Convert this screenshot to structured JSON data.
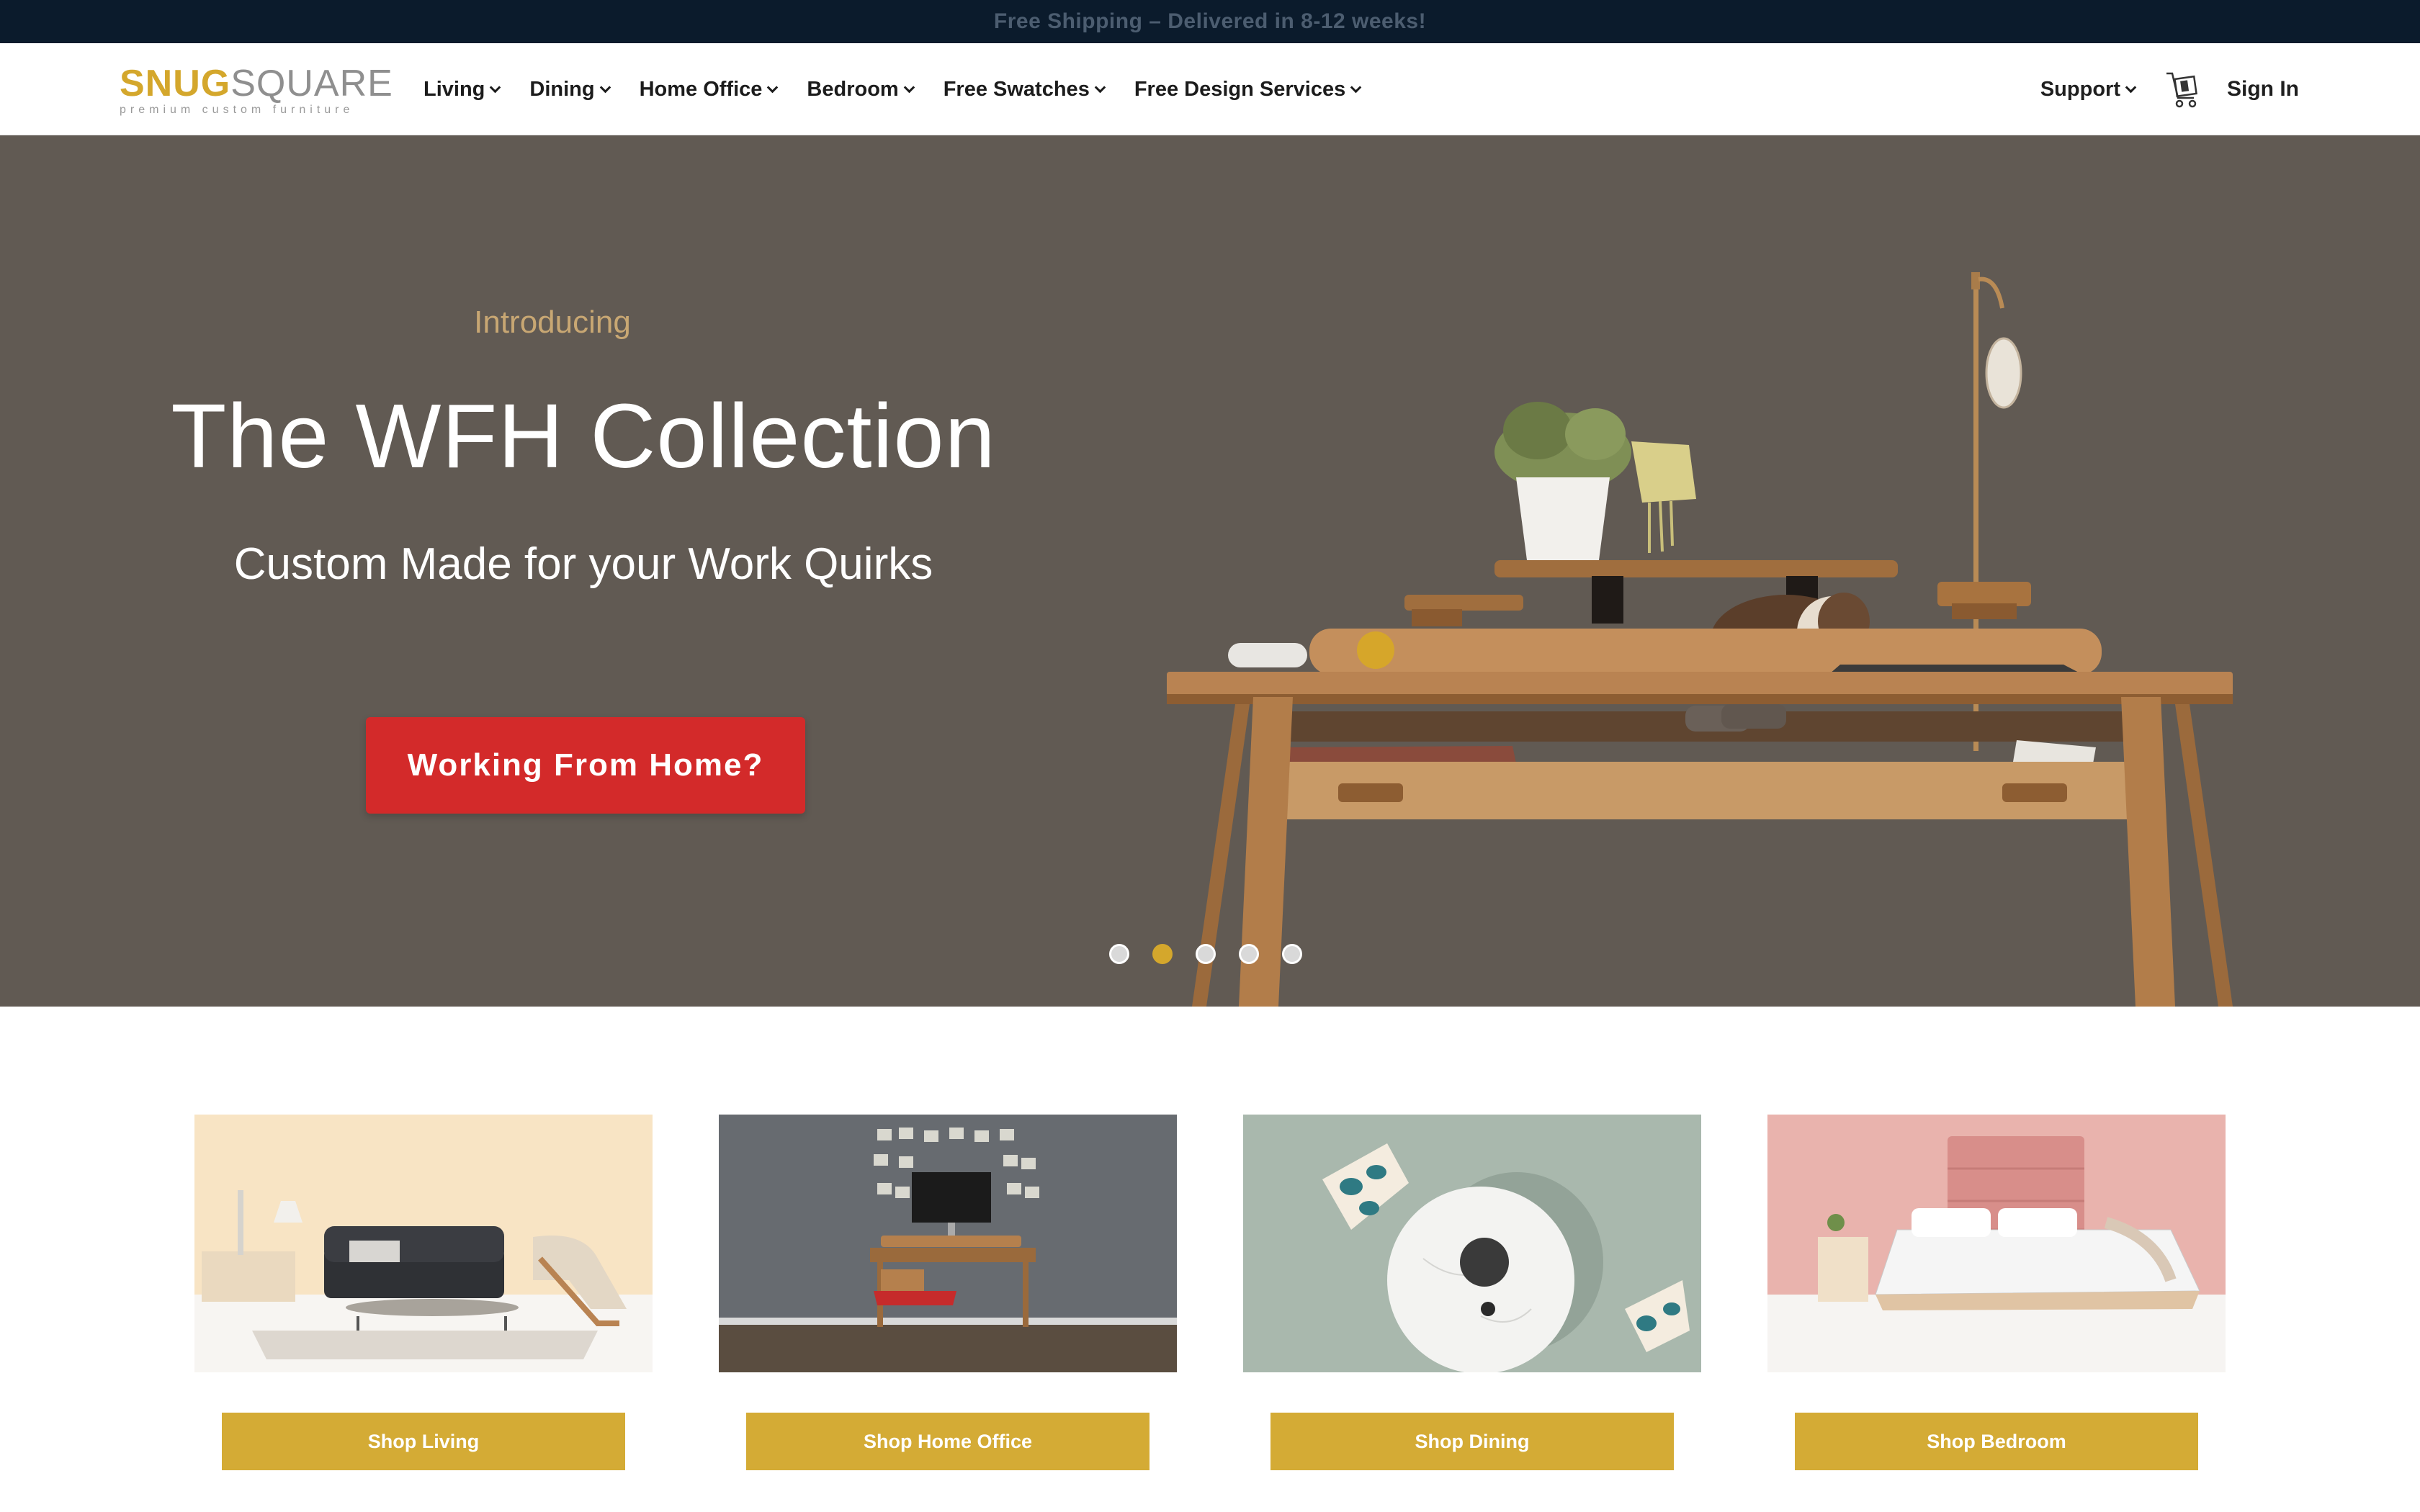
{
  "announcement": "Free Shipping – Delivered in 8-12 weeks!",
  "brand": {
    "name_part1": "SNUG",
    "name_part2": "SQUARE",
    "tagline": "premium custom furniture",
    "gold": "#d4a72c"
  },
  "nav": {
    "items": [
      {
        "label": "Living"
      },
      {
        "label": "Dining"
      },
      {
        "label": "Home Office"
      },
      {
        "label": "Bedroom"
      },
      {
        "label": "Free Swatches"
      },
      {
        "label": "Free Design Services"
      }
    ],
    "support": "Support",
    "cart_icon": "cart-icon",
    "sign_in": "Sign In"
  },
  "hero": {
    "intro": "Introducing",
    "title": "The WFH Collection",
    "subtitle": "Custom Made for your Work Quirks",
    "cta": "Working From Home?",
    "background": "#615a53",
    "cta_color": "#d32a2a",
    "slides_count": 5,
    "active_slide": 2
  },
  "categories": [
    {
      "button": "Shop Living"
    },
    {
      "button": "Shop Home Office"
    },
    {
      "button": "Shop Dining"
    },
    {
      "button": "Shop Bedroom"
    }
  ]
}
